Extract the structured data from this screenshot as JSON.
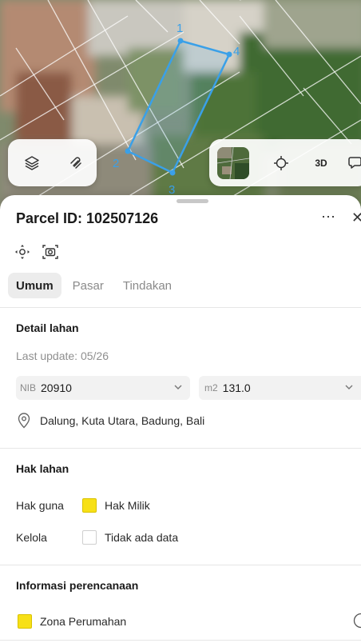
{
  "map": {
    "vertex_labels": [
      "1",
      "2",
      "3",
      "4"
    ],
    "accent_color": "#3aa0e8",
    "controls_left": [
      {
        "icon": "layers-icon"
      },
      {
        "icon": "draw-tool-icon"
      }
    ],
    "controls_right": [
      {
        "icon": "satellite-thumbnail"
      },
      {
        "icon": "crosshair-icon"
      },
      {
        "label": "3D"
      },
      {
        "icon": "chat-bubble-icon"
      }
    ]
  },
  "panel": {
    "title": "Parcel ID: 102507126",
    "more_label": "⋯",
    "close_label": "✕",
    "tabs": [
      {
        "label": "Umum",
        "active": true
      },
      {
        "label": "Pasar",
        "active": false
      },
      {
        "label": "Tindakan",
        "active": false
      }
    ]
  },
  "detail": {
    "heading": "Detail lahan",
    "last_update": "Last update: 05/26",
    "nib_prefix": "NIB",
    "nib_value": "20910",
    "area_prefix": "m2",
    "area_value": "131.0",
    "location": "Dalung, Kuta Utara, Badung, Bali"
  },
  "rights": {
    "heading": "Hak lahan",
    "rows": [
      {
        "label": "Hak guna",
        "value": "Hak Milik",
        "color": "#f7e017"
      },
      {
        "label": "Kelola",
        "value": "Tidak ada data",
        "color": "#ffffff"
      }
    ]
  },
  "planning": {
    "heading": "Informasi perencanaan",
    "zone": "Zona Perumahan",
    "zone_color": "#f7e017"
  }
}
